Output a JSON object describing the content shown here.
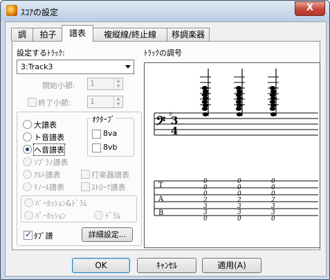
{
  "window": {
    "title": "ｽｺｱの設定",
    "close_symbol": "X"
  },
  "tabs": [
    {
      "label": "調"
    },
    {
      "label": "拍子"
    },
    {
      "label": "譜表"
    },
    {
      "label": "複縦線/終止線"
    },
    {
      "label": "移調楽器"
    }
  ],
  "active_tab": "譜表",
  "track": {
    "label": "設定するﾄﾗｯｸ:",
    "selected": "3:Track3"
  },
  "start_measure": {
    "label": "開始小節:",
    "value": "1"
  },
  "end_measure": {
    "label": "終了小節:",
    "value": "1"
  },
  "staff_types": [
    {
      "label": "大譜表",
      "enabled": true,
      "selected": false
    },
    {
      "label": "ト音譜表",
      "enabled": true,
      "selected": false
    },
    {
      "label": "ヘ音譜表",
      "enabled": true,
      "selected": true
    },
    {
      "label": "ｿﾌﾟﾗﾉ譜表",
      "enabled": false,
      "selected": false
    },
    {
      "label": "ｱﾙﾄ譜表",
      "enabled": false,
      "selected": false
    },
    {
      "label": "ﾃﾉｰﾙ譜表",
      "enabled": false,
      "selected": false
    }
  ],
  "octave": {
    "label": "ｵｸﾀｰﾌﾞ",
    "va8": "8va",
    "vb8": "8vb"
  },
  "percussion_staff": "打楽器譜表",
  "stroke_staff": "ｽﾄﾛｰｸ譜表",
  "percussion_drums": "ﾊﾟｰｶｯｼｮﾝ&ﾄﾞﾗﾑ",
  "percussion": "ﾊﾟｰｶｯｼｮﾝ",
  "drums": "ﾄﾞﾗﾑ",
  "tab_staff": {
    "label": "ﾀﾌﾞ譜",
    "checked": true
  },
  "detail_button": "詳細設定...",
  "preview": {
    "label": "ﾄﾗｯｸの調号",
    "tab_letters": [
      "T",
      "A",
      "B"
    ],
    "chord_fret": [
      "0",
      "0",
      "0",
      "2",
      "3",
      "3",
      "0"
    ]
  },
  "buttons": {
    "ok": "OK",
    "cancel": "ｷｬﾝｾﾙ",
    "apply": "適用(A)"
  }
}
